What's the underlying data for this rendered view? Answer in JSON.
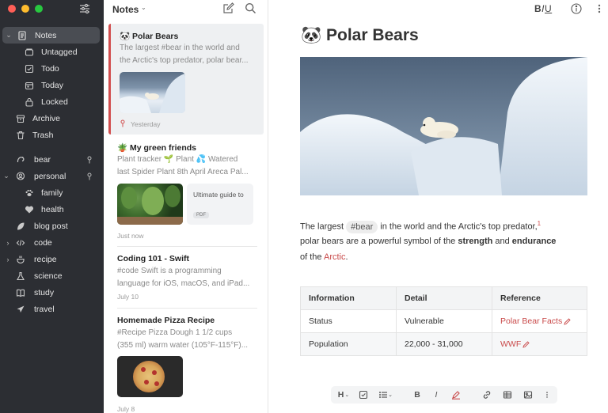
{
  "sidebar": {
    "items": [
      {
        "label": "Notes",
        "icon": "notes-icon",
        "level": 0,
        "chevron": "down",
        "active": true
      },
      {
        "label": "Untagged",
        "icon": "untagged-icon",
        "level": 1
      },
      {
        "label": "Todo",
        "icon": "todo-icon",
        "level": 1
      },
      {
        "label": "Today",
        "icon": "calendar-icon",
        "level": 1
      },
      {
        "label": "Locked",
        "icon": "lock-icon",
        "level": 1
      },
      {
        "label": "Archive",
        "icon": "archive-icon",
        "level": 0
      },
      {
        "label": "Trash",
        "icon": "trash-icon",
        "level": 0
      },
      {
        "label": "bear",
        "icon": "bear-tag-icon",
        "level": 0,
        "pinned": true
      },
      {
        "label": "personal",
        "icon": "personal-tag-icon",
        "level": 0,
        "chevron": "down",
        "pinned": true
      },
      {
        "label": "family",
        "icon": "paw-icon",
        "level": 1
      },
      {
        "label": "health",
        "icon": "heart-icon",
        "level": 1
      },
      {
        "label": "blog post",
        "icon": "leaf-icon",
        "level": 0
      },
      {
        "label": "code",
        "icon": "code-icon",
        "level": 0,
        "chevron": "right"
      },
      {
        "label": "recipe",
        "icon": "recipe-icon",
        "level": 0,
        "chevron": "right"
      },
      {
        "label": "science",
        "icon": "flask-icon",
        "level": 0
      },
      {
        "label": "study",
        "icon": "book-icon",
        "level": 0
      },
      {
        "label": "travel",
        "icon": "plane-icon",
        "level": 0
      }
    ]
  },
  "note_list": {
    "title": "Notes",
    "notes": [
      {
        "title": "🐼 Polar Bears",
        "lines": [
          "The largest #bear in the world and",
          "the Arctic's top predator, polar bear..."
        ],
        "date": "Yesterday",
        "pinned": true,
        "selected": true
      },
      {
        "title": "🪴 My green friends",
        "lines": [
          "Plant tracker 🌱 Plant 💦 Watered",
          "last Spider Plant 8th April Areca Pal..."
        ],
        "date": "Just now",
        "attachment": {
          "title": "Ultimate guide to",
          "badge": "PDF"
        }
      },
      {
        "title": "Coding 101 - Swift",
        "lines": [
          "#code Swift is a programming",
          "language for iOS, macOS, and iPad..."
        ],
        "date": "July 10"
      },
      {
        "title": "Homemade Pizza Recipe",
        "lines": [
          "#Recipe Pizza Dough 1 1/2 cups",
          "(355 ml) warm water (105°F-115°F)..."
        ],
        "date": "July 8"
      }
    ]
  },
  "editor": {
    "format_biu": {
      "b": "B",
      "i": "I",
      "u": "U"
    },
    "title": "🐼 Polar Bears",
    "para": {
      "l1_a": "The largest ",
      "tag": "#bear",
      "l1_b": " in the world and the Arctic's top predator,",
      "footnote": "1",
      "l2_a": "polar bears are a powerful symbol of the ",
      "l2_strength": "strength",
      "l2_and": " and ",
      "l2_endurance": "endurance",
      "l3_a": "of the ",
      "l3_link": "Arctic",
      "l3_b": "."
    },
    "table": {
      "headers": [
        "Information",
        "Detail",
        "Reference"
      ],
      "rows": [
        [
          "Status",
          "Vulnerable",
          "Polar Bear Facts"
        ],
        [
          "Population",
          "22,000 - 31,000",
          "WWF"
        ]
      ]
    },
    "toolbar": {
      "heading": "H"
    }
  },
  "colors": {
    "sidebar_bg": "#2c2e33",
    "accent_red": "#d24f4f",
    "selected_bg": "#eef0f2"
  }
}
